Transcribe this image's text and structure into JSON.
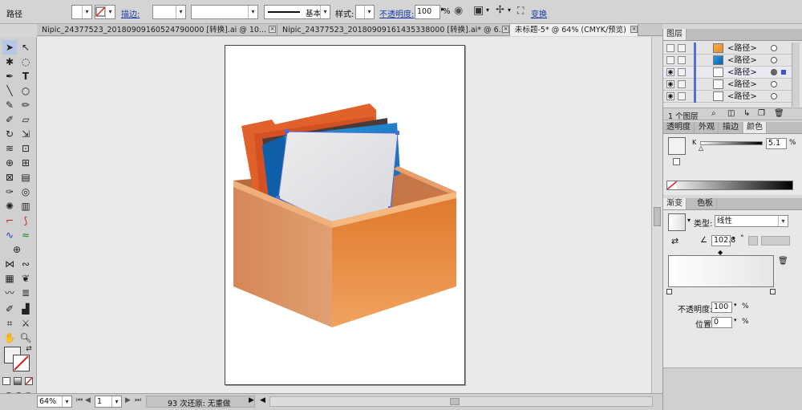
{
  "control_bar": {
    "object_type": "路径",
    "stroke_label": "描边:",
    "stroke_style": "基本",
    "style_label": "样式:",
    "opacity_label": "不透明度:",
    "opacity_value": "100",
    "opacity_unit": "%",
    "transform_label": "变换"
  },
  "doc_tabs": [
    {
      "label": "Nipic_24377523_20180909160524790000 [转换].ai @ 10...",
      "active": false
    },
    {
      "label": "Nipic_24377523_20180909161435338000 [转换].ai* @ 6...",
      "active": false
    },
    {
      "label": "未标题-5* @ 64% (CMYK/预览)",
      "active": true
    }
  ],
  "layers_panel": {
    "title": "图层",
    "rows": [
      {
        "name": "<路径>",
        "thumb": "yellow"
      },
      {
        "name": "<路径>",
        "thumb": "blue"
      },
      {
        "name": "<路径>",
        "thumb": "white"
      },
      {
        "name": "<路径>",
        "thumb": "white"
      },
      {
        "name": "<路径>",
        "thumb": "white"
      }
    ],
    "footer_count": "1 个图层"
  },
  "color_panel": {
    "tabs": [
      "透明度",
      "外观",
      "描边",
      "颜色"
    ],
    "active_tab": "颜色",
    "channel_label": "K",
    "channel_value": "5.1",
    "channel_unit": "%"
  },
  "gradient_panel": {
    "tabs": [
      "渐变",
      "色板"
    ],
    "active_tab": "渐变",
    "type_label": "类型:",
    "type_value": "线性",
    "angle_value": "102.8",
    "angle_unit": "°",
    "opacity_label": "不透明度:",
    "opacity_value": "100",
    "opacity_unit": "%",
    "position_label": "位置:",
    "position_value": "0",
    "position_unit": "%"
  },
  "status_bar": {
    "zoom": "64%",
    "artboard_number": "1",
    "undo_info": "93 次还原: 无重做"
  },
  "colors": {
    "box_front": "#e07a30",
    "box_side": "#d8905f",
    "folder_orange": "#e2602a",
    "folder_blue": "#1d7fc8",
    "selection": "#4a6ae0"
  }
}
